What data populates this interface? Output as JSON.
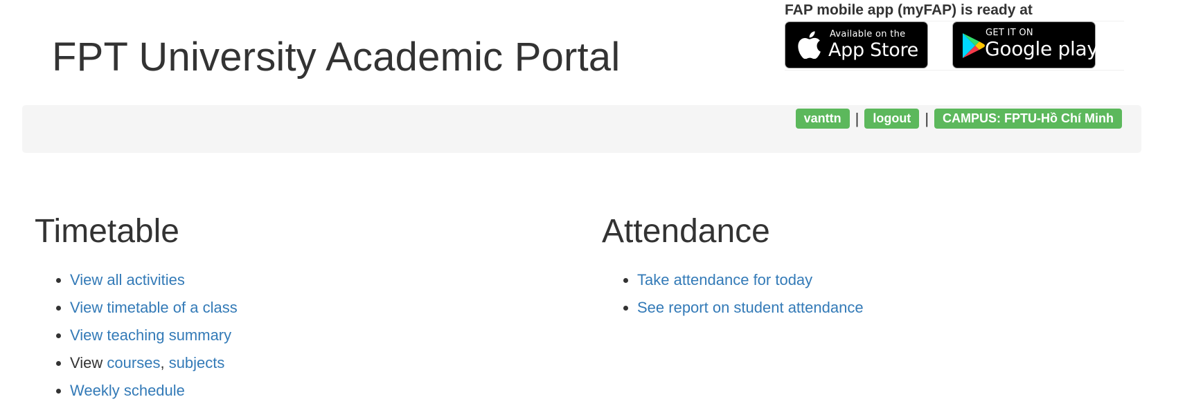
{
  "header": {
    "title": "FPT University Academic Portal"
  },
  "app_promo": {
    "text": "FAP mobile app (myFAP) is ready at",
    "app_store": {
      "small": "Available on the",
      "big": "App Store",
      "icon": "apple-icon"
    },
    "google_play": {
      "small": "GET IT ON",
      "big": "Google play",
      "icon": "google-play-icon"
    }
  },
  "user_bar": {
    "username": "vanttn",
    "logout": "logout",
    "campus": "CAMPUS: FPTU-Hồ Chí Minh",
    "separator": "|",
    "pill_color": "#5cb85c"
  },
  "timetable": {
    "heading": "Timetable",
    "items": {
      "all_activities": "View all activities",
      "class_timetable": "View timetable of a class",
      "teaching_summary": "View teaching summary",
      "view_prefix": "View ",
      "courses": "courses",
      "comma": ", ",
      "subjects": "subjects",
      "weekly_schedule": "Weekly schedule"
    }
  },
  "attendance": {
    "heading": "Attendance",
    "items": {
      "take_today": "Take attendance for today",
      "report": "See report on student attendance"
    }
  },
  "colors": {
    "link": "#337ab7",
    "text": "#333333",
    "bar_background": "#f5f5f5",
    "success": "#5cb85c"
  }
}
